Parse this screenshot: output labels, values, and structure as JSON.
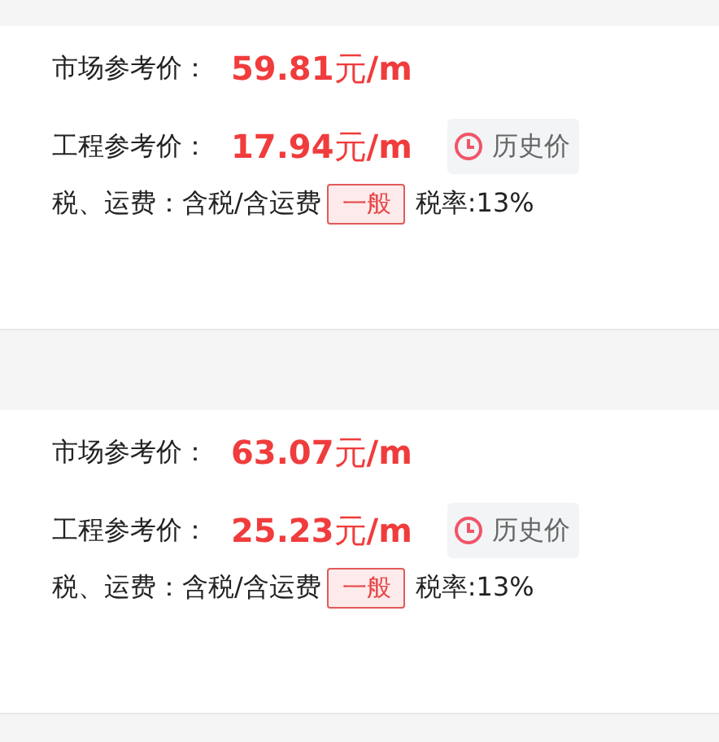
{
  "products": [
    {
      "market_label": "市场参考价：",
      "market_price": "**59.81**元**/m**",
      "project_label": "工程参考价：",
      "project_price": "**17.94**元**/m**",
      "history_button": "历史价",
      "tax_label": "税、运费：",
      "tax_value": "含税/含运费",
      "tax_type": "一般",
      "tax_rate": "税率:13%"
    },
    {
      "market_label": "市场参考价：",
      "market_price": "**63.07**元**/m**",
      "project_label": "工程参考价：",
      "project_price": "**25.23**元**/m**",
      "history_button": "历史价",
      "tax_label": "税、运费：",
      "tax_value": "含税/含运费",
      "tax_type": "一般",
      "tax_rate": "税率:13%"
    }
  ]
}
